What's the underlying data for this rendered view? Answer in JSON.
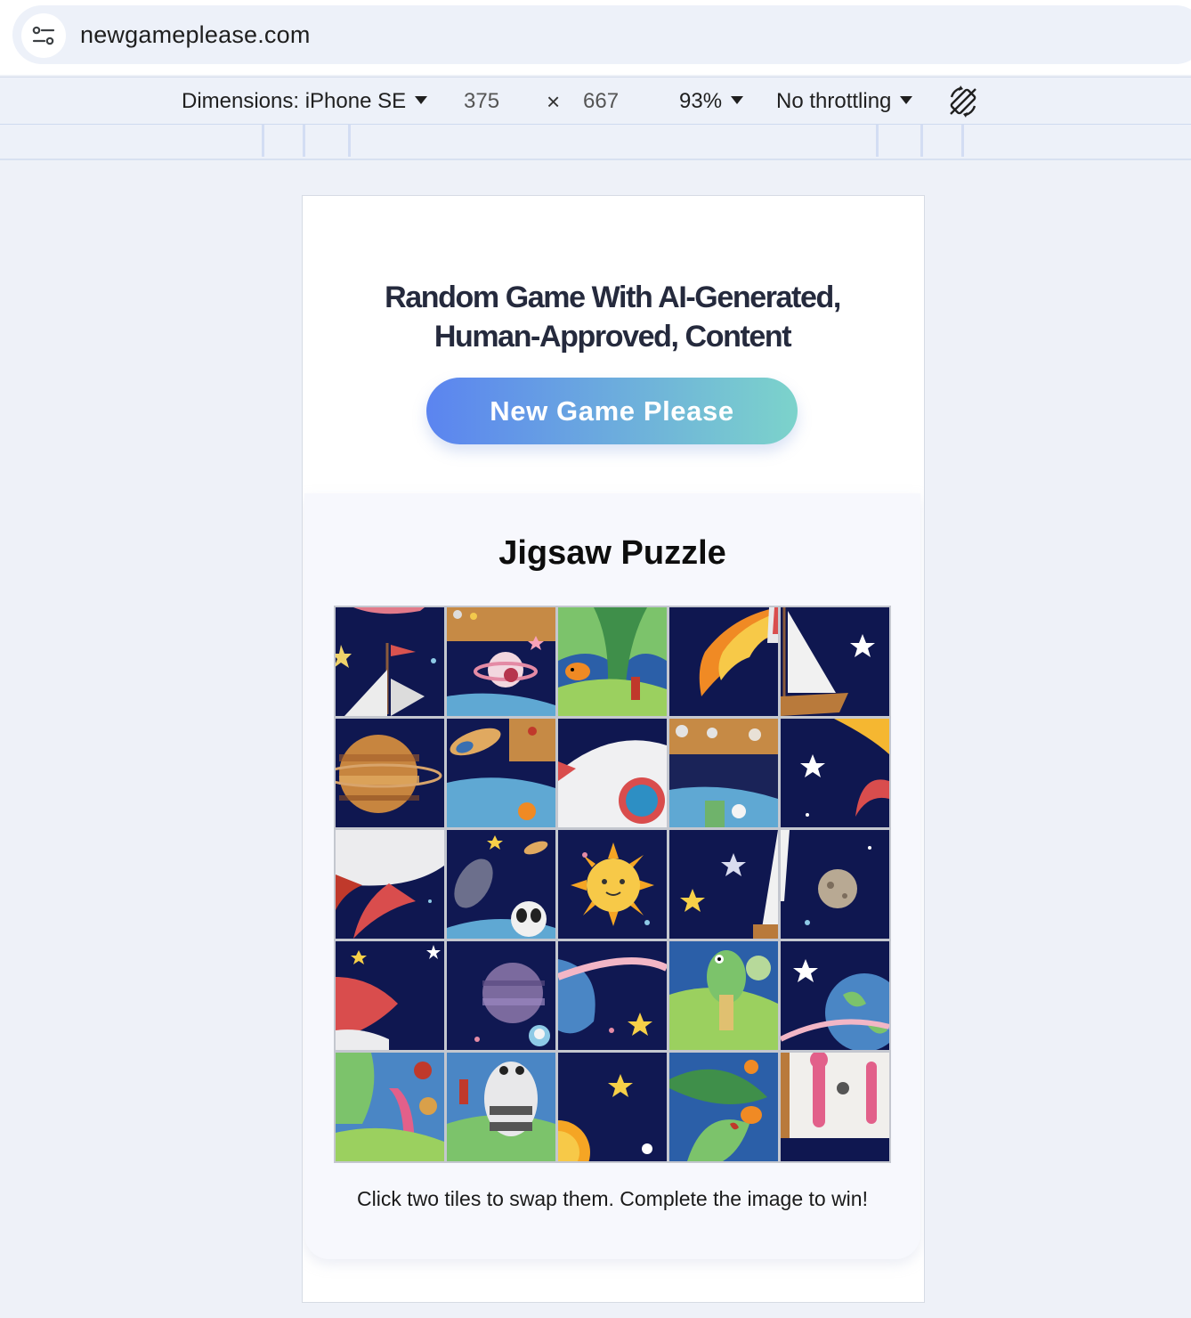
{
  "browser": {
    "url": "newgameplease.com",
    "site_info_icon": "tune-icon"
  },
  "devtools": {
    "dimensions_label": "Dimensions: iPhone SE",
    "width": "375",
    "times": "×",
    "height": "667",
    "zoom": "93%",
    "throttling": "No throttling",
    "rotate_icon": "rotate-device-icon"
  },
  "page": {
    "headline_line1": "Random Game With AI-Generated,",
    "headline_line2": "Human-Approved, Content",
    "new_game_button": "New Game Please",
    "game_title": "Jigsaw Puzzle",
    "instructions": "Click two tiles to swap them. Complete the image to win!",
    "brand_gradient": [
      "#5b84f0",
      "#7cd3cb"
    ]
  },
  "puzzle": {
    "rows": 5,
    "cols": 5,
    "tiles": [
      "space-sailboat-top",
      "saturn-cupboard",
      "green-coral-fish",
      "fire-comet",
      "white-sail-star",
      "striped-planet",
      "rocket-cupboard",
      "rocket-porthole",
      "shelf-critter",
      "sun-rays-moon",
      "rocket-body-red-fin",
      "astronaut-panda-arm",
      "smiling-sun",
      "star-mast",
      "cratered-moon",
      "red-rocket-nose",
      "purple-planet-astronaut",
      "ringed-planet",
      "green-alien-hill",
      "earth-planet",
      "coral-reef-creature",
      "panda-astronaut-legs",
      "sun-corner",
      "leaf-fox",
      "pink-character-window"
    ]
  }
}
